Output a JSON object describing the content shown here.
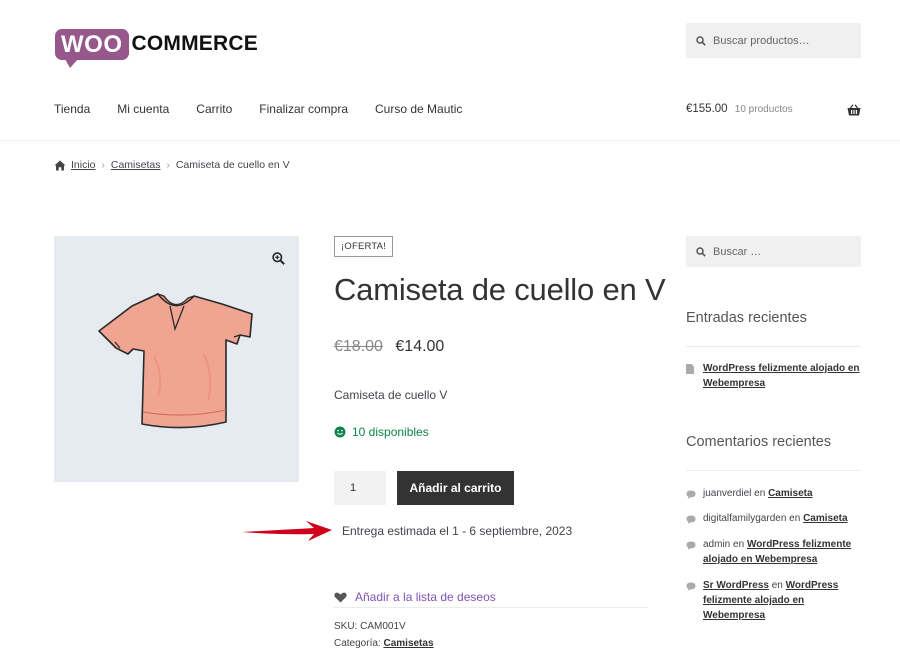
{
  "brand": {
    "woo": "WOO",
    "commerce": "COMMERCE",
    "color": "#96588a"
  },
  "header": {
    "search_placeholder": "Buscar productos…",
    "nav": [
      "Tienda",
      "Mi cuenta",
      "Carrito",
      "Finalizar compra",
      "Curso de Mautic"
    ],
    "cart_total": "€155.00",
    "cart_count": "10 productos"
  },
  "breadcrumb": {
    "home": "Inicio",
    "category": "Camisetas",
    "current": "Camiseta de cuello en V"
  },
  "product": {
    "badge": "¡OFERTA!",
    "title": "Camiseta de cuello en V",
    "old_price": "€18.00",
    "price": "€14.00",
    "description": "Camiseta de cuello V",
    "stock": "10 disponibles",
    "quantity": "1",
    "add_to_cart": "Añadir al carrito",
    "delivery": "Entrega estimada el 1 - 6 septiembre, 2023",
    "wishlist": "Añadir a la lista de deseos",
    "sku_label": "SKU:",
    "sku": "CAM001V",
    "category_label": "Categoría:",
    "category": "Camisetas"
  },
  "sidebar": {
    "search_placeholder": "Buscar …",
    "recent_posts_title": "Entradas recientes",
    "recent_posts": [
      {
        "title": "WordPress felizmente alojado en Webempresa"
      }
    ],
    "recent_comments_title": "Comentarios recientes",
    "recent_comments": [
      {
        "author": "juanverdiel",
        "on": "en",
        "post": "Camiseta"
      },
      {
        "author": "digitalfamilygarden",
        "on": "en",
        "post": "Camiseta"
      },
      {
        "author": "admin",
        "on": "en",
        "post": "WordPress felizmente alojado en Webempresa"
      },
      {
        "author": "Sr WordPress",
        "on": "en",
        "post": "WordPress felizmente alojado en Webempresa"
      }
    ]
  },
  "colors": {
    "stock": "#0f834d",
    "wishlist": "#7f54b3",
    "arrow": "#d0021b",
    "button": "#333333"
  },
  "icons": [
    "search-icon",
    "basket-icon",
    "home-icon",
    "zoom-icon",
    "smiley-icon",
    "heart-icon",
    "document-icon",
    "comment-icon",
    "arrow-icon"
  ]
}
